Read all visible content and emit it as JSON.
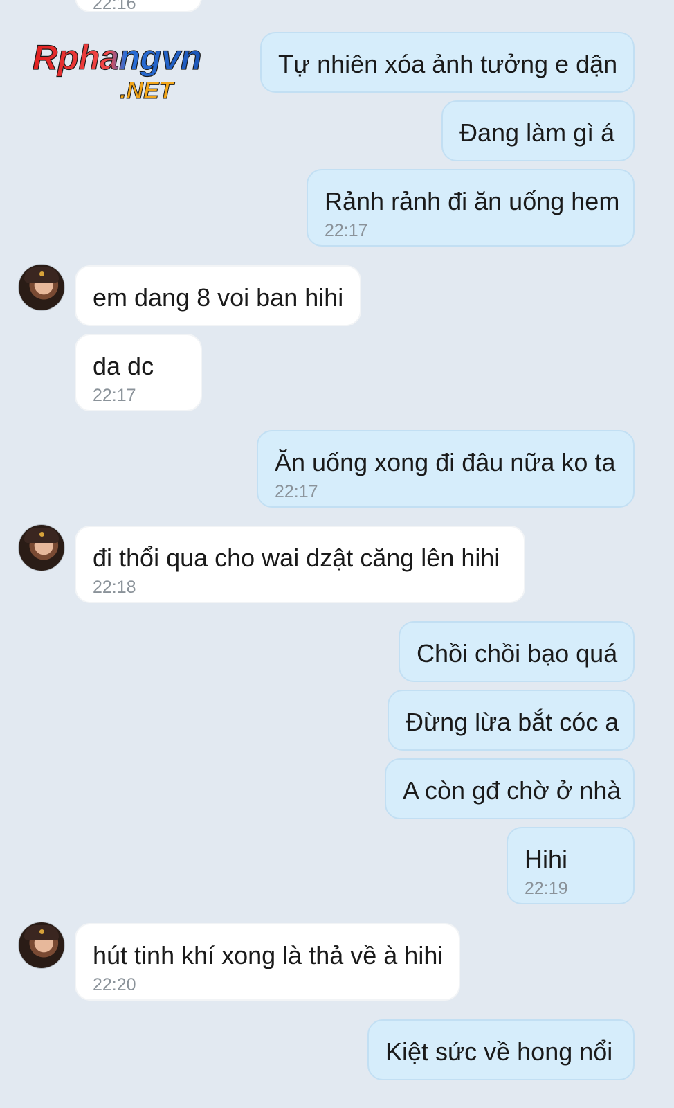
{
  "watermark": {
    "name": "Rphangvn",
    "suffix": ".NET"
  },
  "top_time_fragment": "22:16",
  "messages": [
    {
      "text": "Tự nhiên xóa ảnh tưởng e dận",
      "time": ""
    },
    {
      "text": "Đang làm gì á",
      "time": ""
    },
    {
      "text": "Rảnh rảnh đi ăn uống hem",
      "time": "22:17"
    },
    {
      "text": "em dang 8 voi ban hihi",
      "time": ""
    },
    {
      "text": "da dc",
      "time": "22:17"
    },
    {
      "text": "Ăn uống xong đi đâu nữa ko ta",
      "time": "22:17"
    },
    {
      "text": "đi thổi qua cho wai dzật căng lên hihi",
      "time": "22:18"
    },
    {
      "text": "Chồi chồi bạo quá",
      "time": ""
    },
    {
      "text": "Đừng lừa bắt cóc a",
      "time": ""
    },
    {
      "text": "A còn gđ chờ ở nhà",
      "time": ""
    },
    {
      "text": "Hihi",
      "time": "22:19"
    },
    {
      "text": "hút tinh khí xong là thả về à hihi",
      "time": "22:20"
    },
    {
      "text": "Kiệt sức về hong nổi",
      "time": ""
    }
  ],
  "colors": {
    "background": "#e2e9f1",
    "outgoing": "#d6edfb",
    "incoming": "#ffffff",
    "time": "#8a9299"
  }
}
